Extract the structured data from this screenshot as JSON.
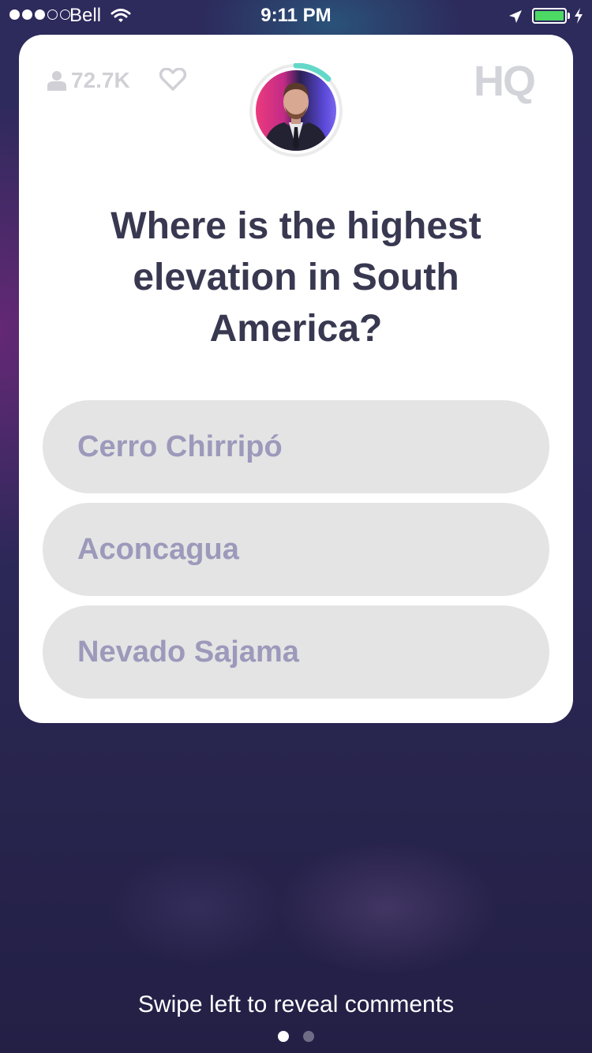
{
  "status_bar": {
    "carrier": "Bell",
    "time": "9:11 PM",
    "signal_bars_filled": 3,
    "signal_bars_total": 5,
    "battery_color": "#4cd964"
  },
  "game": {
    "viewer_count": "72.7K",
    "logo": "HQ",
    "question": "Where is the highest elevation in South America?",
    "answers": [
      {
        "label": "Cerro Chirripó"
      },
      {
        "label": "Aconcagua"
      },
      {
        "label": "Nevado Sajama"
      }
    ],
    "timer_color": "#64d8c8"
  },
  "footer": {
    "swipe_hint": "Swipe left to reveal comments",
    "page_count": 2,
    "active_page": 1
  }
}
